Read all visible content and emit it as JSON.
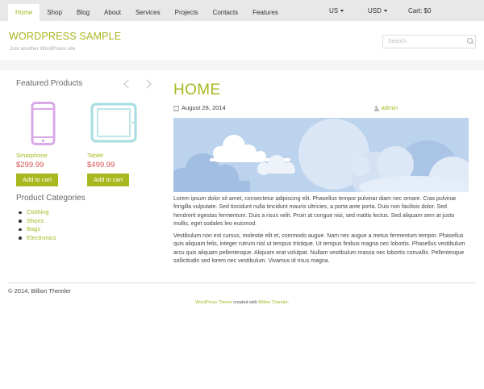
{
  "nav": {
    "items": [
      {
        "label": "Home",
        "active": true
      },
      {
        "label": "Shop"
      },
      {
        "label": "Blog"
      },
      {
        "label": "About"
      },
      {
        "label": "Services"
      },
      {
        "label": "Projects"
      },
      {
        "label": "Contacts"
      },
      {
        "label": "Features"
      }
    ],
    "language": "US",
    "currency": "USD",
    "cart": "Cart: $0"
  },
  "site": {
    "title": "WORDPRESS SAMPLE",
    "tagline": "Just another WordPress site"
  },
  "search": {
    "placeholder": "Search",
    "icon": "search-icon"
  },
  "sidebar": {
    "featured_heading": "Featured Products",
    "products": [
      {
        "name": "Smarphone",
        "price": "$299.99",
        "button": "Add to cart",
        "icon": "smartphone-icon",
        "color": "#d9a9e8"
      },
      {
        "name": "Tablet",
        "price": "$499.99",
        "button": "Add to cart",
        "icon": "tablet-icon",
        "color": "#a6dde0"
      }
    ],
    "categories_heading": "Product Categories",
    "categories": [
      "Clothing",
      "Shoes",
      "Bags",
      "Electronics"
    ]
  },
  "main": {
    "title": "HOME",
    "date": "August 28, 2014",
    "author": "admin",
    "paragraphs": [
      "Lorem ipsum dolor sit amet, consectetur adipiscing elit. Phasellus tempor pulvinar diam nec ornare. Cras pulvinar fringilla vulputate. Sed tincidunt nulla tincidunt mauris ultricies, a porta ante porta. Duis non facilisis dolor. Sed hendrerit egestas fermentum. Duis a risus velit. Proin at congue nisi, sed mattis lectus. Sed aliquam sem at justo mollis, eget sodales leo euismod.",
      "Vestibulum non est cursus, molestie elit et, commodo augue. Nam nec augue a metus fermentum tempor. Phasellus quis aliquam felis, integer rutrum nisl ut tempus tristique. Ut tempus finibus magna nec lobortis. Phasellus vestibulum arcu quis aliquam pellentesque. Aliquam erat volutpat. Nullam vestibulum massa nec lobortis convallis. Pellentesque sollicitudin sed lorem nec vestibulum. Vivamus id risus magna."
    ]
  },
  "footer": {
    "copyright": "© 2014, Billion Themler",
    "theme_link": "WordPress Theme",
    "created_with": " created with ",
    "author_link": "Billion Themler",
    "period": "."
  },
  "colors": {
    "accent": "#a8b820",
    "price": "#d9534f",
    "sky": "#bcd3ee"
  }
}
